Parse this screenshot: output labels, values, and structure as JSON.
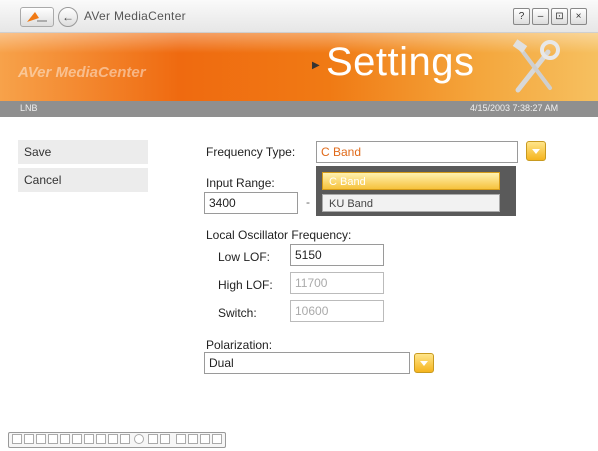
{
  "window": {
    "app_title": "AVer MediaCenter",
    "help_label": "?",
    "minimize_label": "–",
    "fullscreen_label": "⊡",
    "close_label": "×"
  },
  "banner": {
    "brand": "AVer MediaCenter",
    "title": "Settings"
  },
  "statusbar": {
    "section": "LNB",
    "datetime": "4/15/2003 7:38:27 AM"
  },
  "sidebar": {
    "items": [
      {
        "label": "Save"
      },
      {
        "label": "Cancel"
      }
    ]
  },
  "form": {
    "frequency_type": {
      "label": "Frequency Type:",
      "value": "C Band",
      "options": [
        "C Band",
        "KU Band"
      ]
    },
    "input_range": {
      "label": "Input Range:",
      "from": "3400",
      "separator": "-"
    },
    "lof": {
      "label": "Local Oscillator Frequency:",
      "low_label": "Low LOF:",
      "low_value": "5150",
      "high_label": "High LOF:",
      "high_value": "11700",
      "switch_label": "Switch:",
      "switch_value": "10600"
    },
    "polarization": {
      "label": "Polarization:",
      "value": "Dual"
    }
  },
  "colors": {
    "accent_orange": "#ef6a10",
    "dropdown_yellow": "#f5b41e",
    "statusbar_gray": "#8f8f8f"
  }
}
